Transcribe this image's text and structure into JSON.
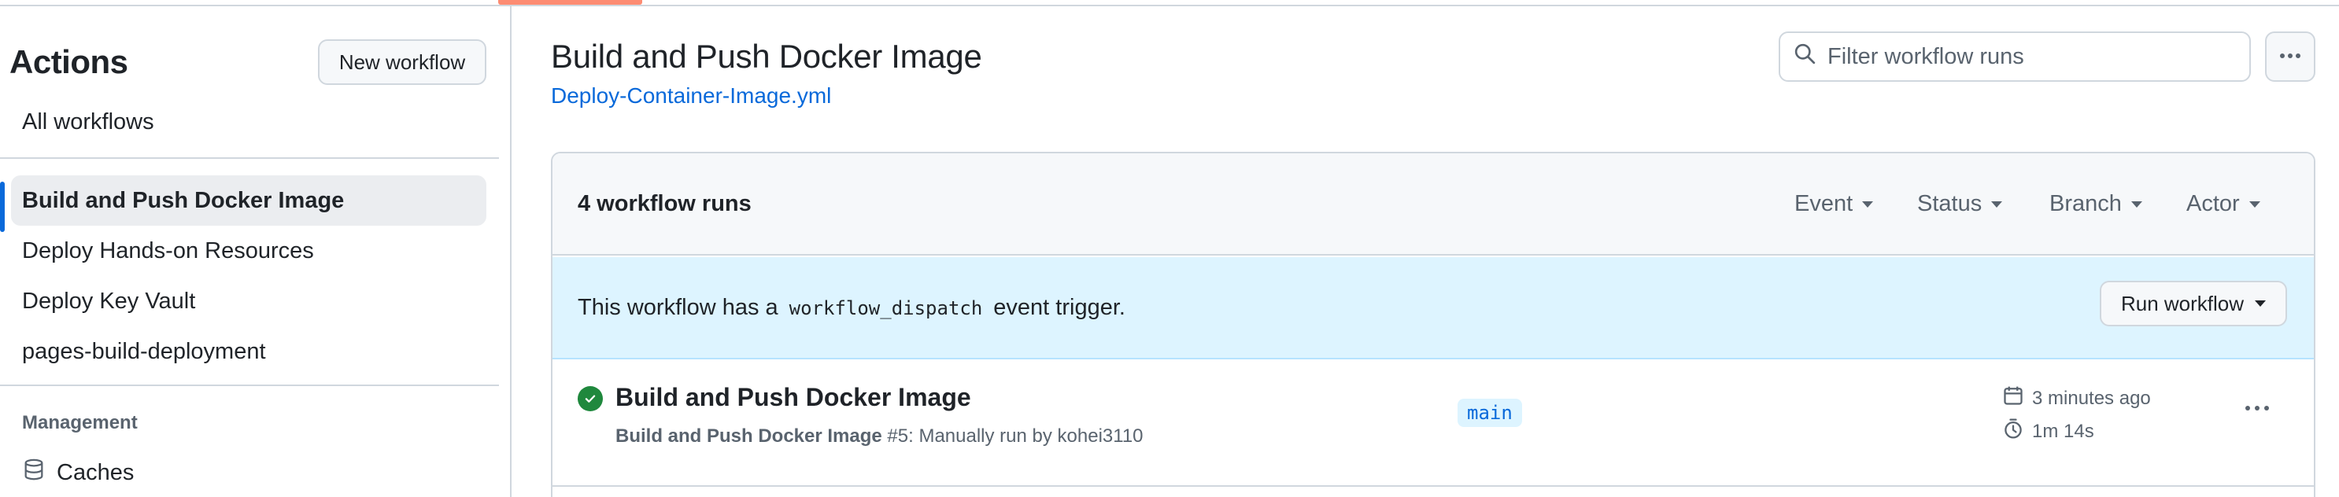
{
  "sidebar": {
    "title": "Actions",
    "new_workflow_label": "New workflow",
    "items": [
      {
        "label": "All workflows"
      },
      {
        "label": "Build and Push Docker Image"
      },
      {
        "label": "Deploy Hands-on Resources"
      },
      {
        "label": "Deploy Key Vault"
      },
      {
        "label": "pages-build-deployment"
      }
    ],
    "management_heading": "Management",
    "caches_label": "Caches"
  },
  "main": {
    "title": "Build and Push Docker Image",
    "file_link": "Deploy-Container-Image.yml",
    "filter_placeholder": "Filter workflow runs",
    "runs_count": "4 workflow runs",
    "filters": [
      "Event",
      "Status",
      "Branch",
      "Actor"
    ],
    "banner": {
      "prefix": "This workflow has a",
      "code": "workflow_dispatch",
      "suffix": "event trigger.",
      "run_button": "Run workflow"
    },
    "runs": [
      {
        "title": "Build and Push Docker Image",
        "workflow_name": "Build and Push Docker Image",
        "details": " #5: Manually run by kohei3110",
        "branch": "main",
        "time_ago": "3 minutes ago",
        "duration": "1m 14s",
        "status": "success"
      }
    ]
  },
  "colors": {
    "accent": "#0969da",
    "success": "#1f883d",
    "underline": "#fd8c73",
    "banner_bg": "#ddf4ff"
  },
  "icons": {
    "filter": "search-icon",
    "more": "kebab-horizontal-icon",
    "caches": "database-icon",
    "status": "check-circle-fill-icon",
    "calendar": "calendar-icon",
    "duration": "stopwatch-icon"
  }
}
